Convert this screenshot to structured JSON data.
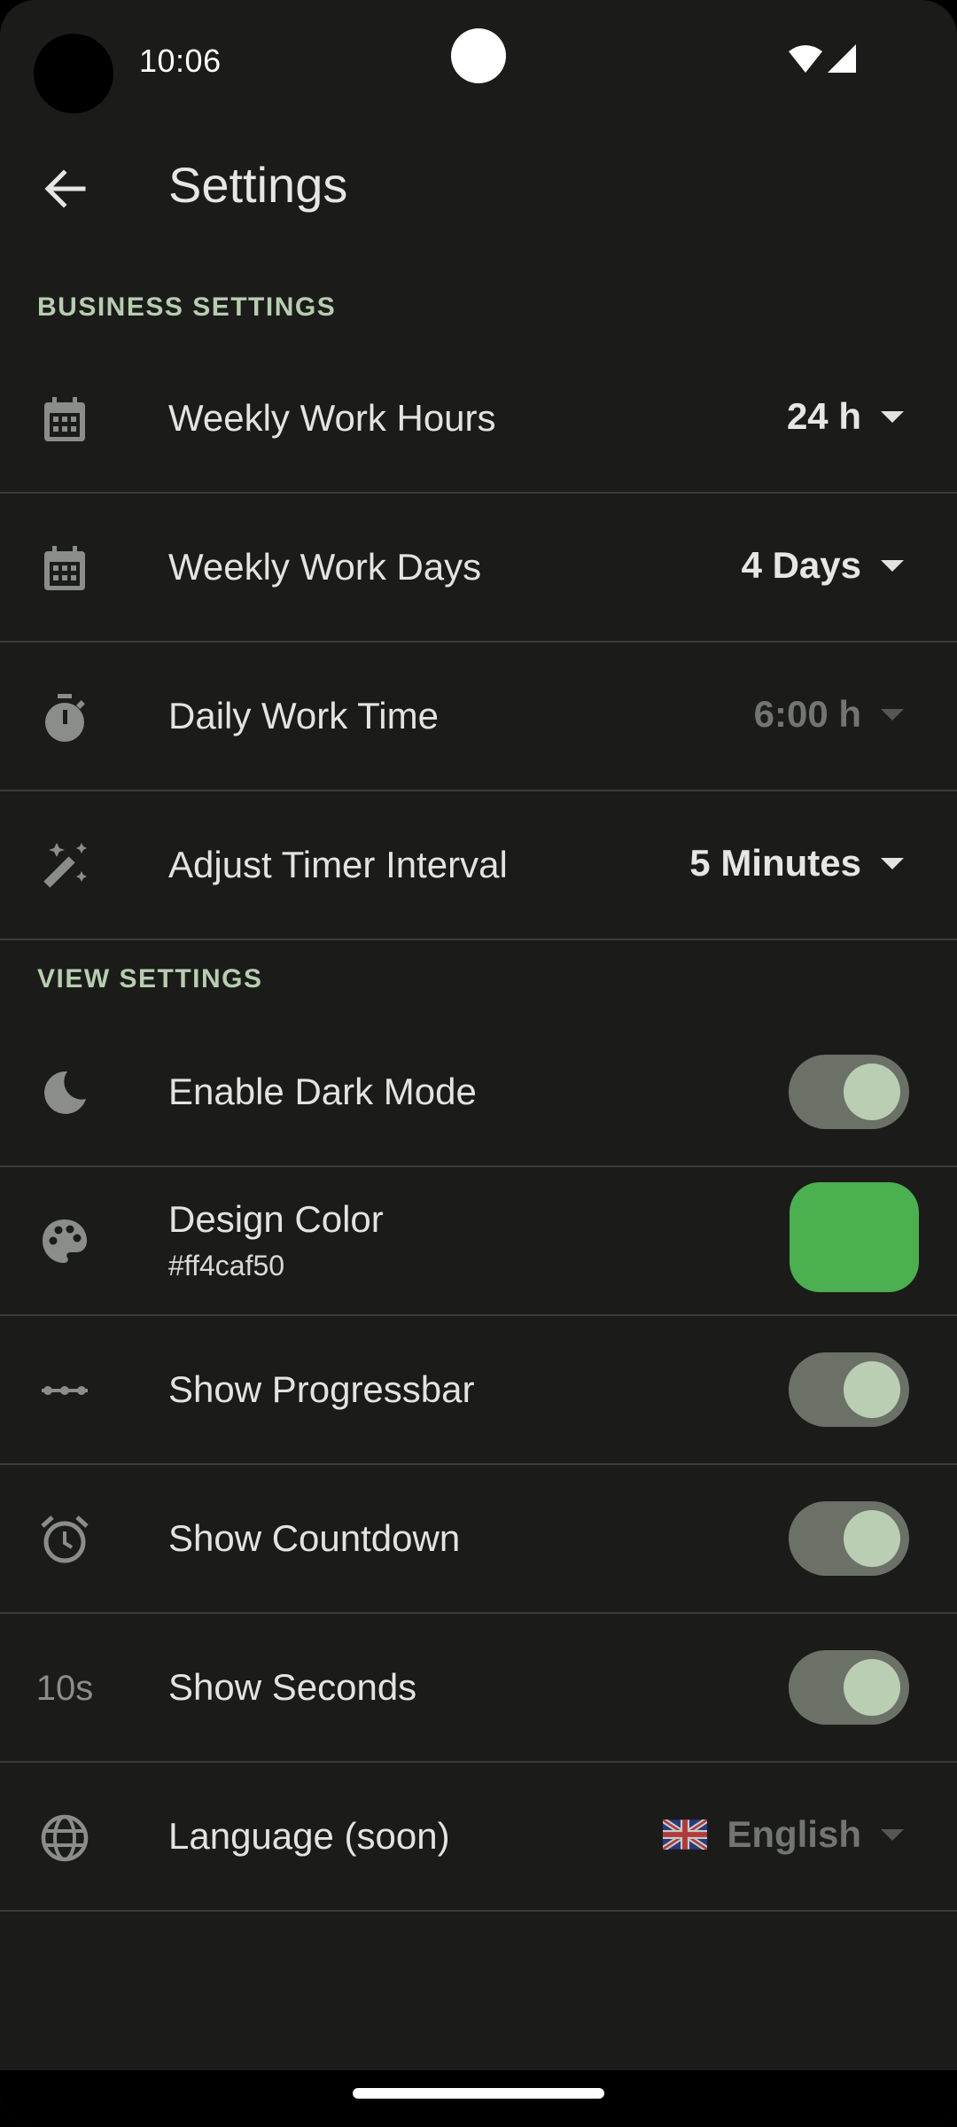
{
  "status_bar": {
    "time": "10:06"
  },
  "app_bar": {
    "title": "Settings",
    "back_icon": "arrow-back-icon"
  },
  "sections": {
    "business": "BUSINESS SETTINGS",
    "view": "VIEW SETTINGS"
  },
  "business_settings": {
    "weekly_work_hours": {
      "label": "Weekly Work Hours",
      "value": "24 h",
      "icon": "calendar-icon"
    },
    "weekly_work_days": {
      "label": "Weekly Work Days",
      "value": "4 Days",
      "icon": "calendar-icon"
    },
    "daily_work_time": {
      "label": "Daily Work Time",
      "value": "6:00 h",
      "icon": "timer-icon",
      "enabled": false
    },
    "timer_interval": {
      "label": "Adjust Timer Interval",
      "value": "5 Minutes",
      "icon": "magic-wand-icon"
    }
  },
  "view_settings": {
    "dark_mode": {
      "label": "Enable Dark Mode",
      "on": true,
      "icon": "moon-icon"
    },
    "design_color": {
      "label": "Design Color",
      "value": "#ff4caf50",
      "swatch": "#4caf50",
      "icon": "palette-icon"
    },
    "progressbar": {
      "label": "Show Progressbar",
      "on": true,
      "icon": "progress-dots-icon"
    },
    "countdown": {
      "label": "Show Countdown",
      "on": true,
      "icon": "alarm-icon"
    },
    "seconds": {
      "label": "Show Seconds",
      "on": true,
      "icon_text": "10s"
    },
    "language": {
      "label": "Language (soon)",
      "value": "English",
      "icon": "globe-icon",
      "flag": "uk-flag-icon",
      "enabled": false
    }
  },
  "colors": {
    "background": "#1b1c1a",
    "accent": "#b7cdb0",
    "toggle_track": "#6c7168",
    "toggle_knob": "#b9ceb3",
    "divider": "#3a3c39"
  }
}
